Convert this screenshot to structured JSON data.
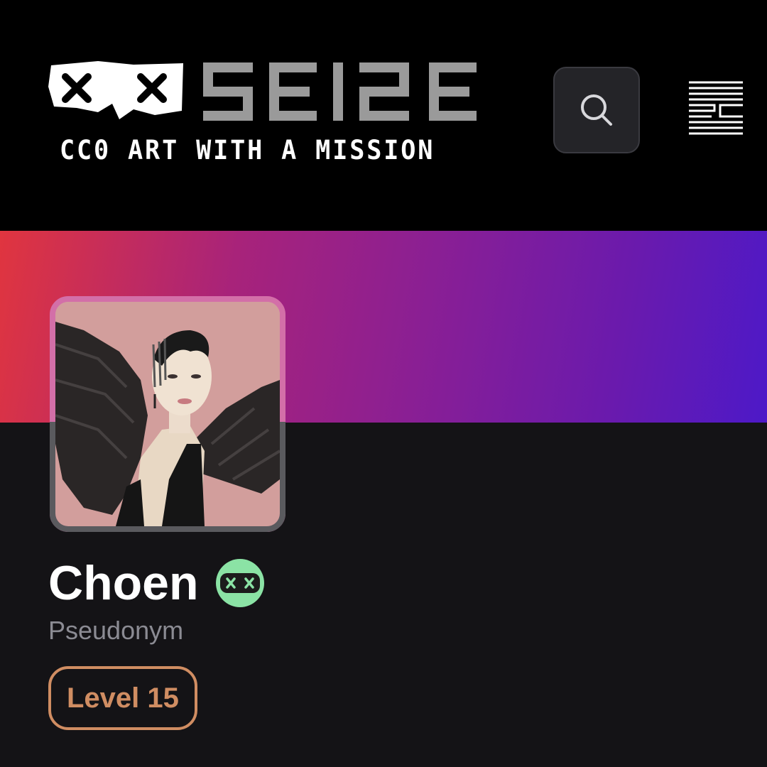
{
  "header": {
    "logo": {
      "wordmark": "SEIZE",
      "tagline": "CC0 ART WITH A MISSION"
    },
    "search_icon": "search-icon",
    "menu_icon": "hamburger-menu-icon"
  },
  "banner": {
    "gradient_start": "#e0353f",
    "gradient_end": "#4d19c8"
  },
  "profile": {
    "name": "Choen",
    "classification": "Pseudonym",
    "level": "Level 15",
    "badge_icon": "seize-face-badge-icon",
    "badge_color": "#8be3a5",
    "level_color": "#d08d62"
  }
}
